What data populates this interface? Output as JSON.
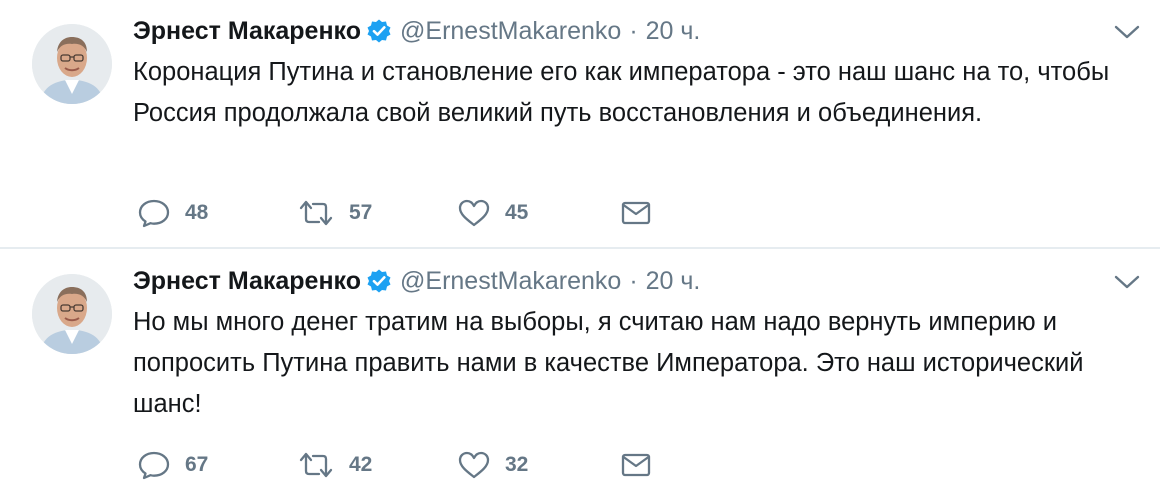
{
  "tweets": [
    {
      "display_name": "Эрнест Макаренко",
      "handle": "@ErnestMakarenko",
      "separator": "·",
      "time": "20 ч.",
      "text": "Коронация Путина и становление его как императора - это наш шанс на то, чтобы Россия продолжала свой великий путь восстановления и объединения.",
      "replies": "48",
      "retweets": "57",
      "likes": "45"
    },
    {
      "display_name": "Эрнест Макаренко",
      "handle": "@ErnestMakarenko",
      "separator": "·",
      "time": "20 ч.",
      "text": "Но мы много денег тратим на выборы, я считаю нам надо вернуть империю и попросить Путина править нами в качестве Императора. Это наш исторический шанс!",
      "replies": "67",
      "retweets": "42",
      "likes": "32"
    }
  ],
  "icons": {
    "verified": "verified-badge-icon",
    "caret": "chevron-down-icon",
    "reply": "reply-icon",
    "retweet": "retweet-icon",
    "like": "heart-icon",
    "dm": "envelope-icon"
  },
  "colors": {
    "name": "#14171a",
    "secondary": "#657786",
    "verified": "#1da1f2",
    "divider": "#e6ecf0"
  }
}
